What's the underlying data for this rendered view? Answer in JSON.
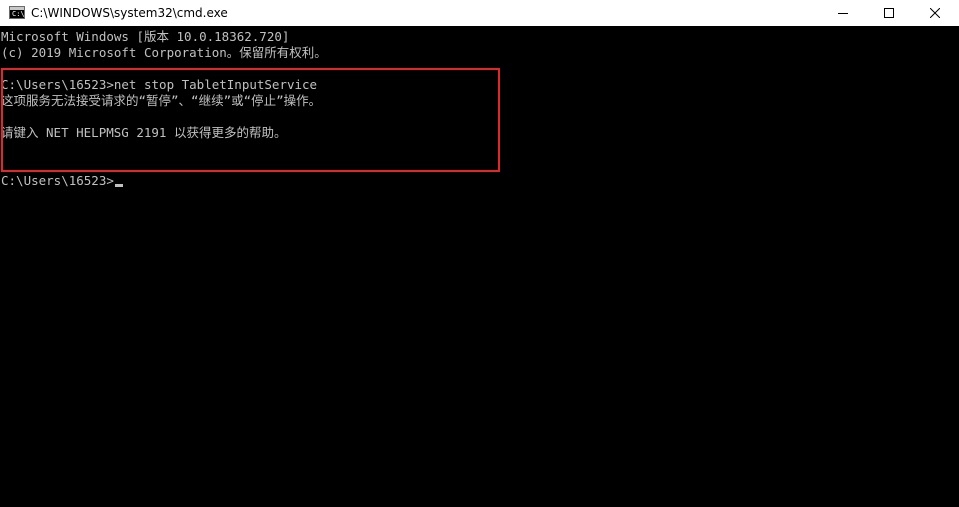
{
  "window": {
    "title": "C:\\WINDOWS\\system32\\cmd.exe",
    "app_icon_glyph": "C:\\",
    "highlight_color": "#e0282b",
    "console_text_color": "#c0c0c0",
    "console_bg_color": "#000000"
  },
  "console": {
    "lines": [
      "Microsoft Windows [版本 10.0.18362.720]",
      "(c) 2019 Microsoft Corporation。保留所有权利。",
      "C:\\Users\\16523>net stop TabletInputService",
      "这项服务无法接受请求的“暂停”、“继续”或“停止”操作。",
      "请键入 NET HELPMSG 2191 以获得更多的帮助。",
      "C:\\Users\\16523>"
    ]
  }
}
